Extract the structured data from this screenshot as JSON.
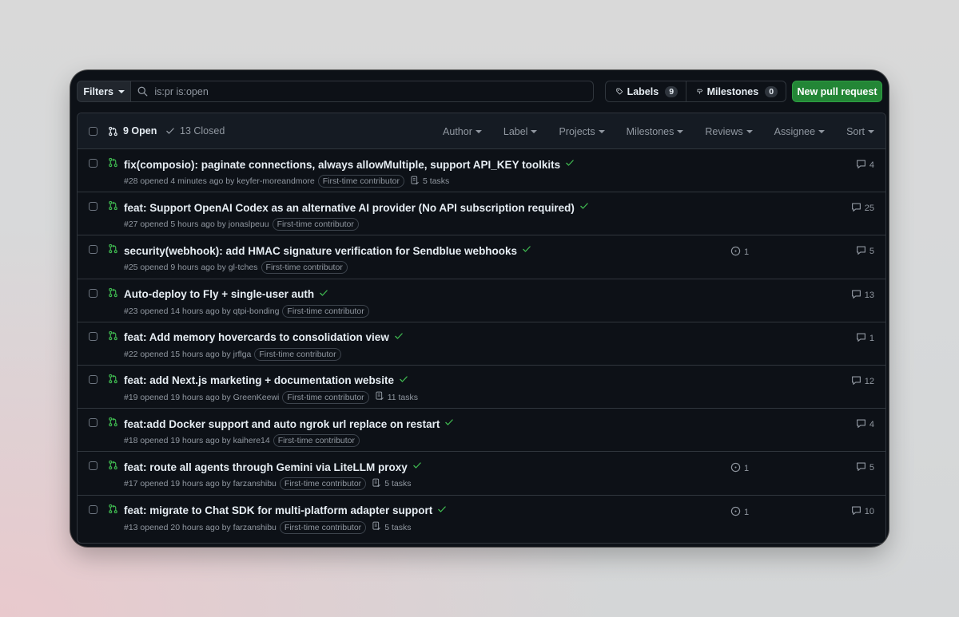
{
  "topbar": {
    "filters_label": "Filters",
    "search_value": "is:pr is:open",
    "labels_label": "Labels",
    "labels_count": "9",
    "milestones_label": "Milestones",
    "milestones_count": "0",
    "new_pr_label": "New pull request"
  },
  "header": {
    "open_label": "9 Open",
    "closed_label": "13 Closed",
    "filters": [
      "Author",
      "Label",
      "Projects",
      "Milestones",
      "Reviews",
      "Assignee",
      "Sort"
    ]
  },
  "colors": {
    "background": "#0d1117",
    "accent_green": "#3fb950",
    "button_green": "#238636",
    "muted_text": "#9198a1"
  },
  "pull_requests": [
    {
      "title": "fix(composio): paginate connections, always allowMultiple, support API_KEY toolkits",
      "meta": "#28 opened 4 minutes ago by keyfer-moreandmore",
      "label": "First-time contributor",
      "tasks": "5 tasks",
      "issues": "",
      "comments": "4"
    },
    {
      "title": "feat: Support OpenAI Codex as an alternative AI provider (No API subscription required)",
      "meta": "#27 opened 5 hours ago by jonaslpeuu",
      "label": "First-time contributor",
      "tasks": "",
      "issues": "",
      "comments": "25"
    },
    {
      "title": "security(webhook): add HMAC signature verification for Sendblue webhooks",
      "meta": "#25 opened 9 hours ago by gl-tches",
      "label": "First-time contributor",
      "tasks": "",
      "issues": "1",
      "comments": "5"
    },
    {
      "title": "Auto-deploy to Fly + single-user auth",
      "meta": "#23 opened 14 hours ago by qtpi-bonding",
      "label": "First-time contributor",
      "tasks": "",
      "issues": "",
      "comments": "13"
    },
    {
      "title": "feat: Add memory hovercards to consolidation view",
      "meta": "#22 opened 15 hours ago by jrflga",
      "label": "First-time contributor",
      "tasks": "",
      "issues": "",
      "comments": "1"
    },
    {
      "title": "feat: add Next.js marketing + documentation website",
      "meta": "#19 opened 19 hours ago by GreenKeewi",
      "label": "First-time contributor",
      "tasks": "11 tasks",
      "issues": "",
      "comments": "12"
    },
    {
      "title": "feat:add Docker support and auto ngrok url replace on restart",
      "meta": "#18 opened 19 hours ago by kaihere14",
      "label": "First-time contributor",
      "tasks": "",
      "issues": "",
      "comments": "4"
    },
    {
      "title": "feat: route all agents through Gemini via LiteLLM proxy",
      "meta": "#17 opened 19 hours ago by farzanshibu",
      "label": "First-time contributor",
      "tasks": "5 tasks",
      "issues": "1",
      "comments": "5"
    },
    {
      "title": "feat: migrate to Chat SDK for multi-platform adapter support",
      "meta": "#13 opened 20 hours ago by farzanshibu",
      "label": "First-time contributor",
      "tasks": "5 tasks",
      "issues": "1",
      "comments": "10"
    }
  ]
}
